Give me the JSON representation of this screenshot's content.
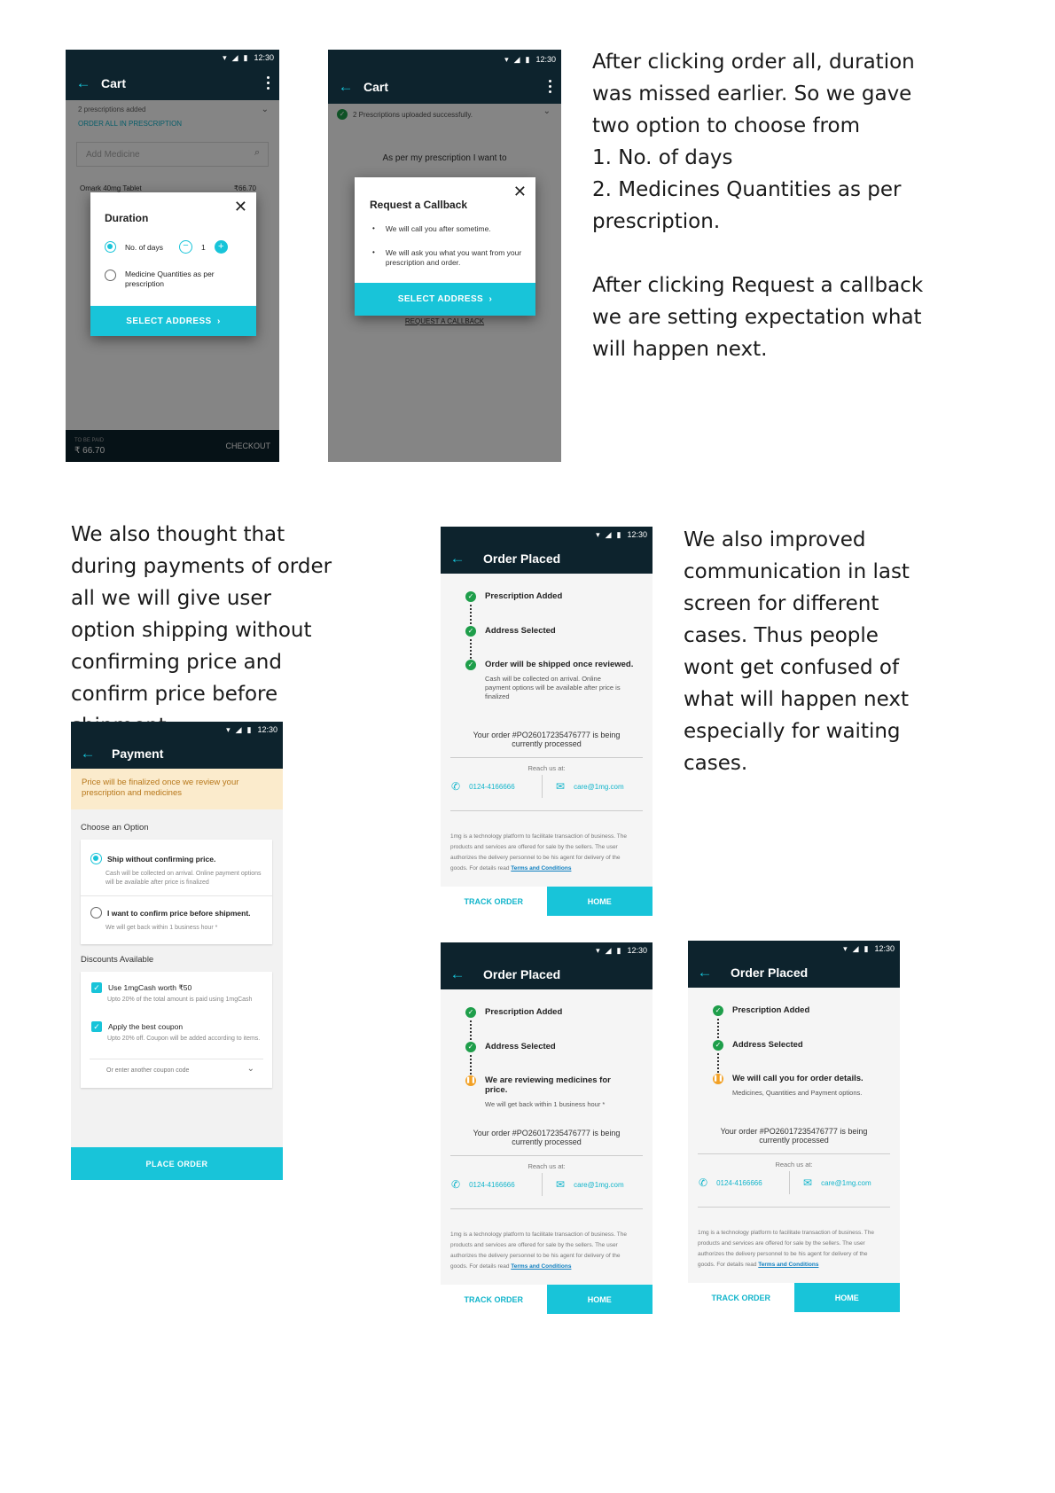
{
  "status_time": "12:30",
  "captions": {
    "c1": "After clicking order all, duration was missed earlier. So we gave two option to choose from\n1. No. of days\n2. Medicines Quantities as per prescription.\n\nAfter clicking Request a callback we are setting expectation what will happen next.",
    "c2": "We also thought that during payments of order all we will give user option shipping without confirming price and confirm price before shipment.",
    "c3": "We also improved communication in last screen for different cases. Thus people wont get confused of what will happen next especially for waiting cases."
  },
  "screen_duration": {
    "title": "Cart",
    "prescriptions_added": "2 prescriptions added",
    "order_all": "ORDER ALL IN PRESCRIPTION",
    "add_medicine_placeholder": "Add Medicine",
    "bg_item": "Omark 40mg Tablet",
    "bg_price": "₹66.70",
    "modal": {
      "title": "Duration",
      "opt1": "No. of days",
      "qty": "1",
      "opt2": "Medicine Quantities as per prescription",
      "cta": "SELECT ADDRESS"
    },
    "to_be_paid_label": "TO BE PAID",
    "to_be_paid_value": "₹ 66.70",
    "checkout": "CHECKOUT"
  },
  "screen_callback": {
    "title": "Cart",
    "uploaded": "2 Prescriptions uploaded successfully.",
    "want_to": "As per my prescription I want to",
    "modal": {
      "title": "Request a Callback",
      "bullet1": "We will call you after sometime.",
      "bullet2": "We will ask you what you want from your prescription and order.",
      "cta": "SELECT ADDRESS"
    },
    "bg_link": "REQUEST A CALLBACK"
  },
  "screen_payment": {
    "title": "Payment",
    "notice": "Price will be finalized once we review your prescription and medicines",
    "choose_label": "Choose an Option",
    "opt1_title": "Ship without confirming price.",
    "opt1_sub": "Cash will be collected on arrival. Online payment options will be available after price is finalized",
    "opt2_title": "I want to confirm price before shipment.",
    "opt2_sub": "We will get back within 1 business hour *",
    "discounts_label": "Discounts Available",
    "d1_title": "Use 1mgCash worth ₹50",
    "d1_sub": "Upto 20% of the total amount is paid using 1mgCash",
    "d2_title": "Apply the best coupon",
    "d2_sub": "Upto 20% off. Coupon will be added according to items.",
    "coupon_placeholder": "Or enter another coupon code",
    "cta": "PLACE ORDER"
  },
  "order_common": {
    "title": "Order Placed",
    "step1": "Prescription Added",
    "step2": "Address Selected",
    "order_line1": "Your order #PO26017235476777 is being",
    "order_line2": "currently processed",
    "reach": "Reach us at:",
    "phone": "0124-4166666",
    "email": "care@1mg.com",
    "disclaimer": "1mg is a technology platform to facilitate transaction of business. The products and services are offered for sale by the sellers. The user authorizes the delivery personnel to be his agent for delivery of the goods. For details read",
    "terms": "Terms and Conditions",
    "track": "TRACK ORDER",
    "home": "HOME"
  },
  "order_a": {
    "step3": "Order will be shipped once reviewed.",
    "step3_sub": "Cash will be collected on arrival. Online payment options will be available after price is finalized"
  },
  "order_b": {
    "step3": "We are reviewing medicines for price.",
    "step3_sub": "We will get back within 1 business hour *"
  },
  "order_c": {
    "step3": "We will call you for order details.",
    "step3_sub": "Medicines, Quantities and Payment options."
  },
  "colors": {
    "appbar": "#0d232d",
    "accent": "#18c4d9",
    "success": "#1e9e4a",
    "pending": "#f2a023"
  }
}
